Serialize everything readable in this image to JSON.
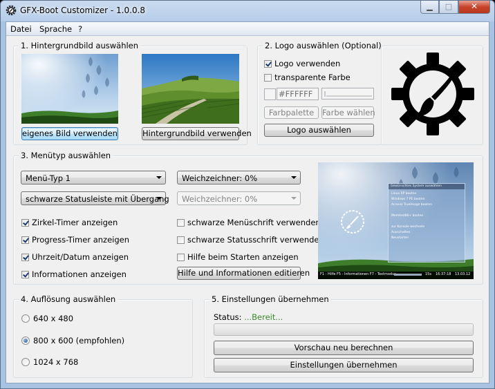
{
  "window": {
    "title": "GFX-Boot Customizer - 1.0.0.8"
  },
  "menu": [
    "Datei",
    "Sprache",
    "?"
  ],
  "group1": {
    "title": "1. Hintergrundbild auswählen",
    "own_image_button": "eigenes Bild verwenden",
    "bg_image_button": "Hintergrundbild verwenden"
  },
  "group2": {
    "title": "2. Logo auswählen (Optional)",
    "use_logo_label": "Logo verwenden",
    "use_logo_checked": true,
    "transparent_label": "transparente Farbe",
    "transparent_checked": false,
    "color_value": "#FFFFFF",
    "palette_button": "Farbpalette",
    "pick_color_button": "Farbe wählen",
    "select_logo_button": "Logo auswählen"
  },
  "group3": {
    "title": "3. Menütyp auswählen",
    "menu_type_select": "Menü-Typ 1",
    "blur1_select": "Weichzeichner: 0%",
    "statusbar_select": "schwarze Statusleiste mit Übergang",
    "blur2_select": "Weichzeichner: 0%",
    "checks_left": [
      {
        "label": "Zirkel-Timer anzeigen",
        "checked": true
      },
      {
        "label": "Progress-Timer anzeigen",
        "checked": true
      },
      {
        "label": "Uhrzeit/Datum anzeigen",
        "checked": true
      },
      {
        "label": "Informationen anzeigen",
        "checked": true
      }
    ],
    "checks_right": [
      {
        "label": "schwarze Menüschrift verwenden",
        "checked": false
      },
      {
        "label": "schwarze Statusschrift verwenden",
        "checked": false
      },
      {
        "label": "Hilfe beim Starten anzeigen",
        "checked": false
      }
    ],
    "edit_help_button": "Hilfe und Informationen editieren",
    "preview": {
      "menu_header": "Gewünschtes System auswählen",
      "menu_items": [
        "Linux XP booten",
        "Windows 7 PE booten",
        "Acronis TrueImage booten",
        "",
        "Memtest86+ booten",
        "",
        "zur Konsole wechseln",
        "Ausschalten",
        "Neustarten"
      ],
      "status_left": "F1 - Hilfe   F5 - Informationen   F7 - Textmodus",
      "status_time_left": "15s",
      "status_time": "16:37:18",
      "status_date": "13.03.12"
    }
  },
  "group4": {
    "title": "4. Auflösung auswählen",
    "options": [
      {
        "label": "640 x 480",
        "selected": false
      },
      {
        "label": "800 x 600 (empfohlen)",
        "selected": true
      },
      {
        "label": "1024 x 768",
        "selected": false
      }
    ]
  },
  "group5": {
    "title": "5. Einstellungen übernehmen",
    "status_label": "Status:",
    "status_value": "...Bereit...",
    "preview_button": "Vorschau neu berechnen",
    "apply_button": "Einstellungen übernehmen"
  },
  "colors": {
    "status_green": "#3a8a2c",
    "accent_blue": "#3c7fb1"
  },
  "progress": {
    "fraction": 0
  }
}
